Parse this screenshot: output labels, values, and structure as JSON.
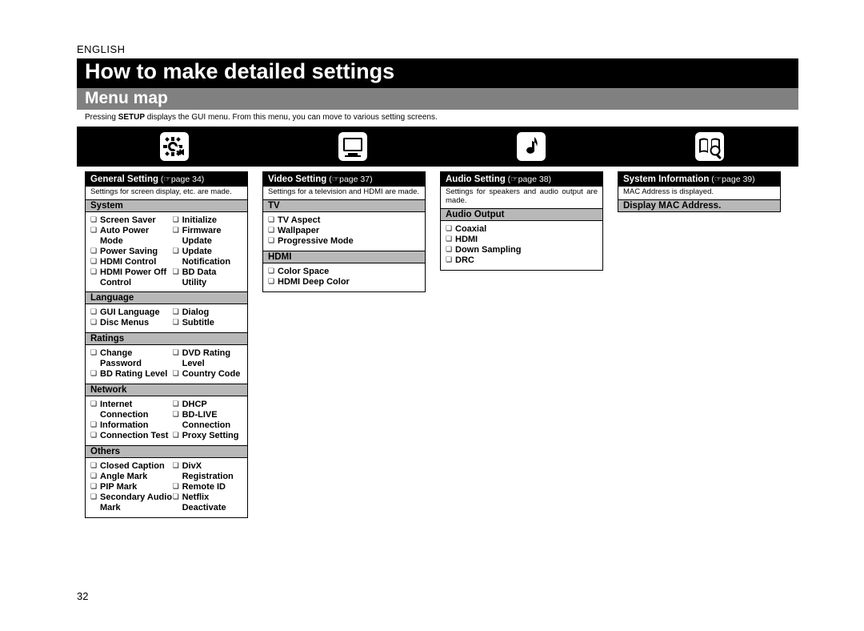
{
  "lang": "ENGLISH",
  "title": "How to make detailed settings",
  "subtitle": "Menu map",
  "intro_prefix": "Pressing ",
  "intro_bold": "SETUP",
  "intro_suffix": " displays the GUI menu. From this menu, you can move to various setting screens.",
  "page_number": "32",
  "icons": {
    "gear": "gear-icon",
    "monitor": "monitor-icon",
    "music": "music-note-icon",
    "book": "book-magnifier-icon"
  },
  "cards": {
    "general": {
      "title": "General Setting",
      "ref": " (☞page 34)",
      "desc": "Settings for screen display, etc. are made.",
      "sections": {
        "system": {
          "head": "System",
          "left": [
            "Screen Saver",
            "Auto Power Mode",
            "Power Saving",
            "HDMI Control",
            "HDMI Power Off Control"
          ],
          "right": [
            "Initialize",
            "Firmware Update",
            "Update Notification",
            "BD Data Utility"
          ]
        },
        "language": {
          "head": "Language",
          "left": [
            "GUI Language",
            "Disc Menus"
          ],
          "right": [
            "Dialog",
            "Subtitle"
          ]
        },
        "ratings": {
          "head": "Ratings",
          "left": [
            "Change Password",
            "BD Rating Level"
          ],
          "right": [
            "DVD Rating Level",
            "Country Code"
          ]
        },
        "network": {
          "head": "Network",
          "left": [
            "Internet Connection",
            "Information",
            "Connection Test"
          ],
          "right": [
            "DHCP",
            "BD-LIVE Connection",
            "Proxy Setting"
          ]
        },
        "others": {
          "head": "Others",
          "left": [
            "Closed Caption",
            "Angle Mark",
            "PIP Mark",
            "Secondary Audio Mark"
          ],
          "right": [
            "DivX Registration",
            "Remote ID",
            "Netflix Deactivate"
          ]
        }
      }
    },
    "video": {
      "title": "Video Setting",
      "ref": " (☞page 37)",
      "desc": "Settings for a television and HDMI are made.",
      "sections": {
        "tv": {
          "head": "TV",
          "items": [
            "TV Aspect",
            "Wallpaper",
            "Progressive Mode"
          ]
        },
        "hdmi": {
          "head": "HDMI",
          "items": [
            "Color Space",
            "HDMI Deep Color"
          ]
        }
      }
    },
    "audio": {
      "title": "Audio Setting",
      "ref": " (☞page 38)",
      "desc": "Settings for speakers and audio output are made.",
      "sections": {
        "output": {
          "head": "Audio Output",
          "items": [
            "Coaxial",
            "HDMI",
            "Down Sampling",
            "DRC"
          ]
        }
      }
    },
    "sysinfo": {
      "title": "System Information",
      "ref": " (☞page 39)",
      "desc": "MAC Address is displayed.",
      "body": "Display MAC Address."
    }
  }
}
